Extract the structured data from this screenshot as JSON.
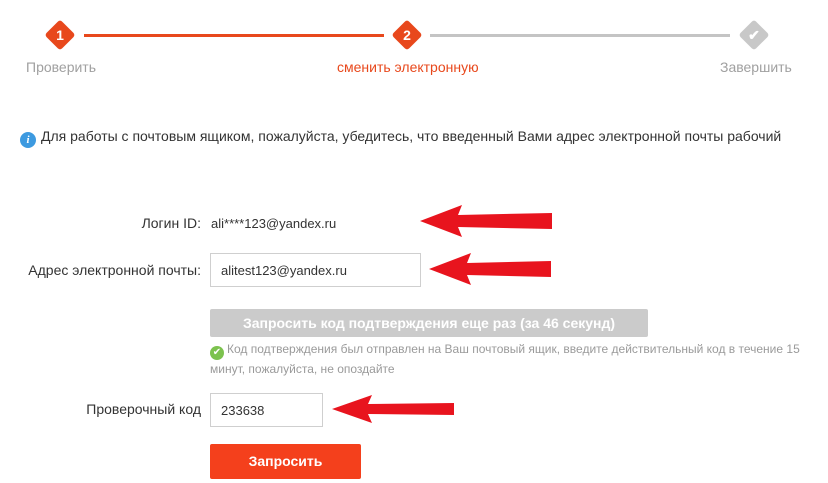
{
  "stepper": {
    "steps": [
      {
        "number": "1",
        "label": "Проверить"
      },
      {
        "number": "2",
        "label": "сменить электронную"
      },
      {
        "number": "✔",
        "label": "Завершить"
      }
    ]
  },
  "notice": {
    "icon": "info-icon",
    "text": "Для работы с почтовым ящиком, пожалуйста, убедитесь, что введенный Вами адрес электронной почты рабочий"
  },
  "form": {
    "login_label": "Логин ID:",
    "login_value": "ali****123@yandex.ru",
    "email_label": "Адрес электронной почты:",
    "email_value": "alitest123@yandex.ru",
    "resend_button": "Запросить код подтверждения еще раз (за 46 секунд)",
    "success_message": "Код подтверждения был отправлен на Ваш почтовый ящик, введите действительный код в течение 15 минут, пожалуйста, не опоздайте",
    "code_label": "Проверочный код",
    "code_value": "233638",
    "submit_button": "Запросить"
  },
  "colors": {
    "accent": "#e8481c",
    "submit": "#f4401c",
    "disabled": "#cbcbcb",
    "arrow": "#e8141e",
    "info": "#3d9ae0",
    "success": "#7cc24e"
  }
}
